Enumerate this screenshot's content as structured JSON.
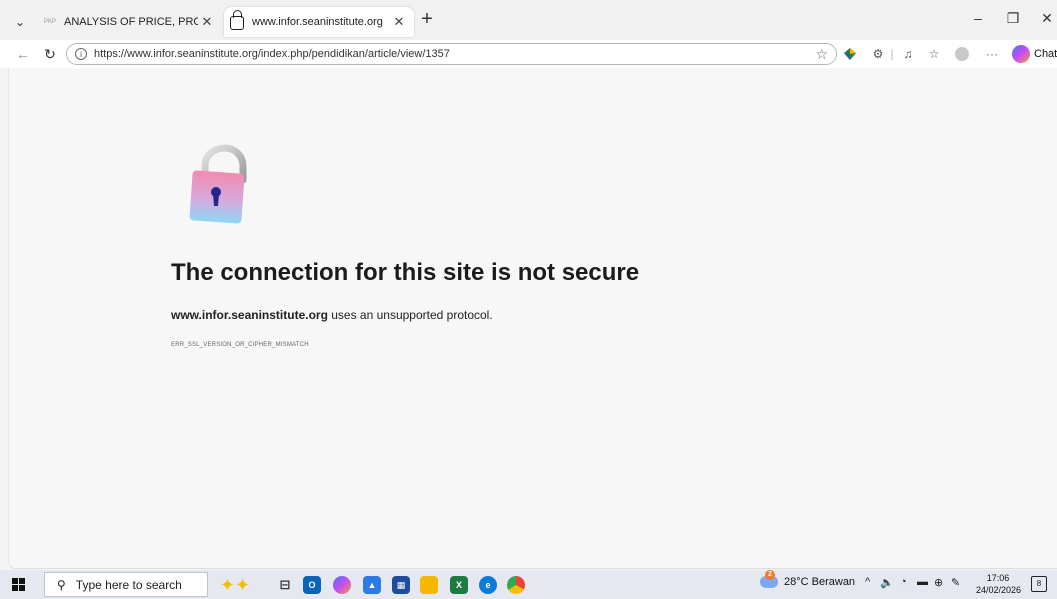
{
  "tabs": [
    {
      "favicon_text": "PKP",
      "title": "ANALYSIS OF PRICE, PROMOTION,",
      "close": "✕"
    },
    {
      "title": "www.infor.seaninstitute.org",
      "close": "✕"
    }
  ],
  "toolbar": {
    "url": "https://www.infor.seaninstitute.org/index.php/pendidikan/article/view/1357",
    "chat_label": "Chat"
  },
  "error_page": {
    "headline": "The connection for this site is not secure",
    "host": "www.infor.seaninstitute.org",
    "desc_rest": " uses an unsupported protocol.",
    "error_code": "ERR_SSL_VERSION_OR_CIPHER_MISMATCH"
  },
  "taskbar": {
    "search_placeholder": "Type here to search",
    "weather_badge": "2",
    "weather_text": "28°C  Berawan",
    "time": "17:06",
    "date": "24/02/2026",
    "notification_count": "8"
  },
  "colors": {
    "accent_blue": "#0078d4",
    "lock_pink": "#f28bb0",
    "lock_blue": "#8ed7f5",
    "keyhole": "#202a8c"
  }
}
